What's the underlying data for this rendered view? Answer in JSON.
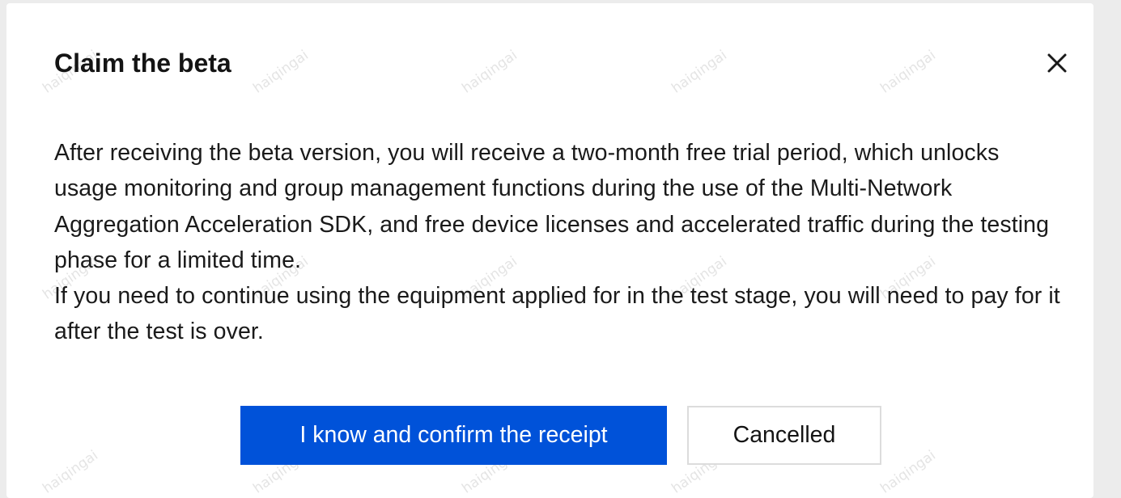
{
  "dialog": {
    "title": "Claim the beta",
    "close_icon": "close-icon",
    "paragraphs": [
      "After receiving the beta version, you will receive a two-month free trial period, which unlocks usage monitoring and group management functions during the use of the Multi-Network Aggregation Acceleration SDK, and free device licenses and accelerated traffic during the testing phase for a limited time.",
      "If you need to continue using the equipment applied for in the test stage, you will need to pay for it after the test is over."
    ],
    "confirm_label": "I know and confirm the receipt",
    "cancel_label": "Cancelled",
    "watermark_text": "haiqingai"
  },
  "colors": {
    "primary": "#0052d9",
    "text": "#141414",
    "border": "#dcdcdc",
    "background": "#ffffff"
  }
}
